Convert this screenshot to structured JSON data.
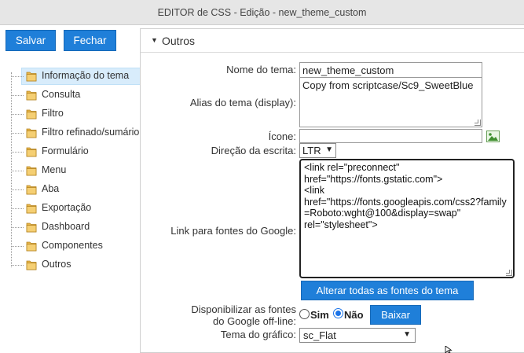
{
  "window": {
    "title": "EDITOR de CSS - Edição - new_theme_custom"
  },
  "toolbar": {
    "save_label": "Salvar",
    "close_label": "Fechar"
  },
  "sidebar": {
    "items": [
      {
        "label": "Informação do tema",
        "selected": true
      },
      {
        "label": "Consulta"
      },
      {
        "label": "Filtro"
      },
      {
        "label": "Filtro refinado/sumário"
      },
      {
        "label": "Formulário"
      },
      {
        "label": "Menu"
      },
      {
        "label": "Aba"
      },
      {
        "label": "Exportação"
      },
      {
        "label": "Dashboard"
      },
      {
        "label": "Componentes"
      },
      {
        "label": "Outros"
      }
    ]
  },
  "panel": {
    "title": "Outros",
    "fields": {
      "theme_name": {
        "label": "Nome do tema:",
        "value": "new_theme_custom"
      },
      "theme_alias": {
        "label": "Alias do tema (display):",
        "value": "Copy from scriptcase/Sc9_SweetBlue"
      },
      "icon": {
        "label": "Ícone:",
        "value": ""
      },
      "writing_direction": {
        "label": "Direção da escrita:",
        "value": "LTR"
      },
      "google_fonts_link": {
        "label": "Link para fontes do Google:",
        "value": "<link rel=\"preconnect\"\nhref=\"https://fonts.gstatic.com\">\n<link\nhref=\"https://fonts.googleapis.com/css2?family=Roboto:wght@100&display=swap\"\nrel=\"stylesheet\">"
      },
      "offline_fonts": {
        "label_line1": "Disponibilizar as fontes",
        "label_line2": "do Google off-line:",
        "option_yes": "Sim",
        "option_no": "Não",
        "selected": "Não"
      },
      "chart_theme": {
        "label": "Tema do gráfico:",
        "value": "sc_Flat"
      }
    },
    "buttons": {
      "change_all_fonts": "Alterar todas as fontes do tema",
      "download": "Baixar"
    }
  },
  "colors": {
    "accent": "#1f7fd9",
    "selection": "#d8ecfb",
    "folder": "#e8b64a"
  }
}
